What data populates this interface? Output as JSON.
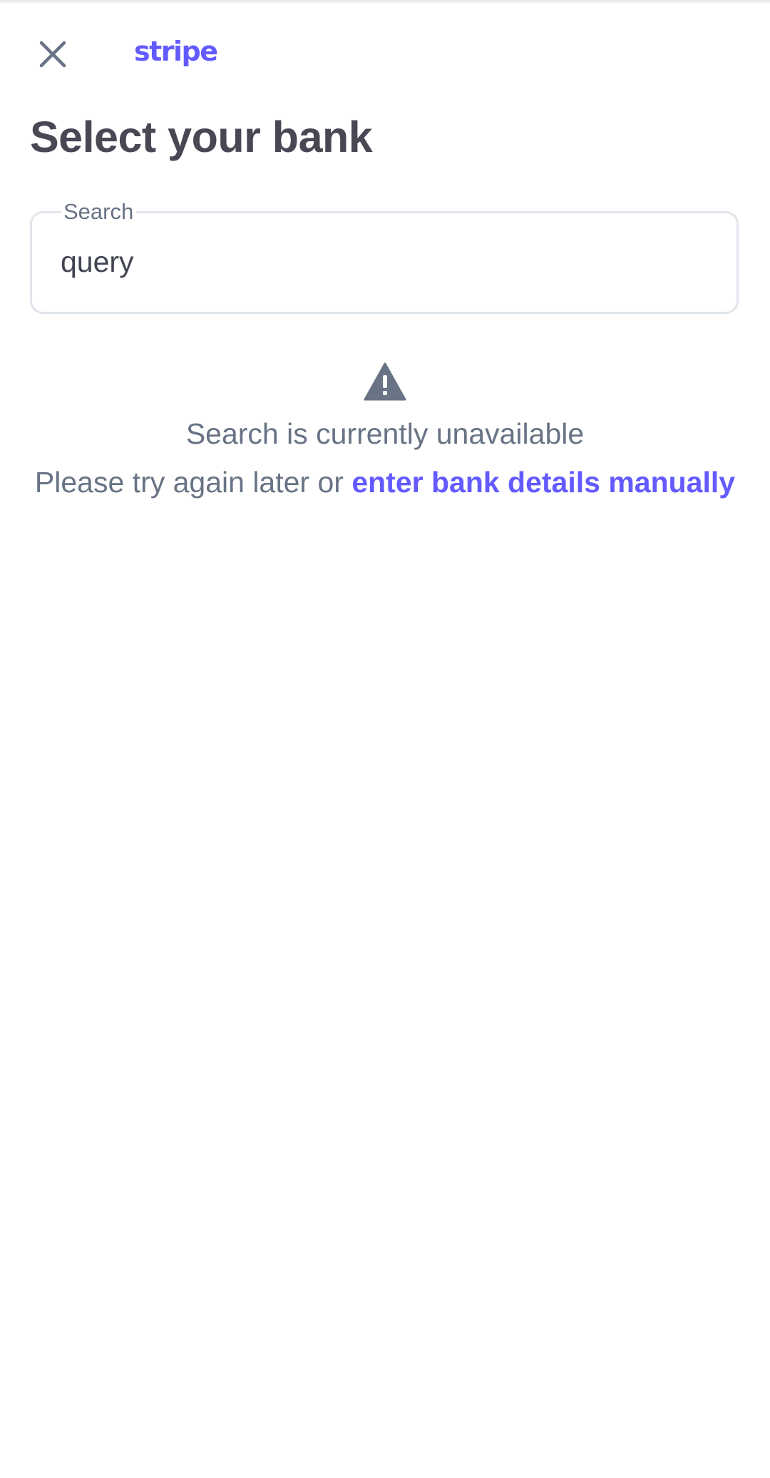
{
  "header": {
    "close_icon": "close-icon",
    "brand": "stripe",
    "brand_color": "#635bff"
  },
  "page": {
    "title": "Select your bank"
  },
  "search": {
    "label": "Search",
    "value": "query"
  },
  "status": {
    "icon": "warning-icon",
    "title": "Search is currently unavailable",
    "message_prefix": "Please try again later or ",
    "link_text": "enter bank details manually"
  },
  "colors": {
    "accent": "#635bff",
    "heading": "#474853",
    "muted": "#687385",
    "border": "#e0e6eb"
  }
}
